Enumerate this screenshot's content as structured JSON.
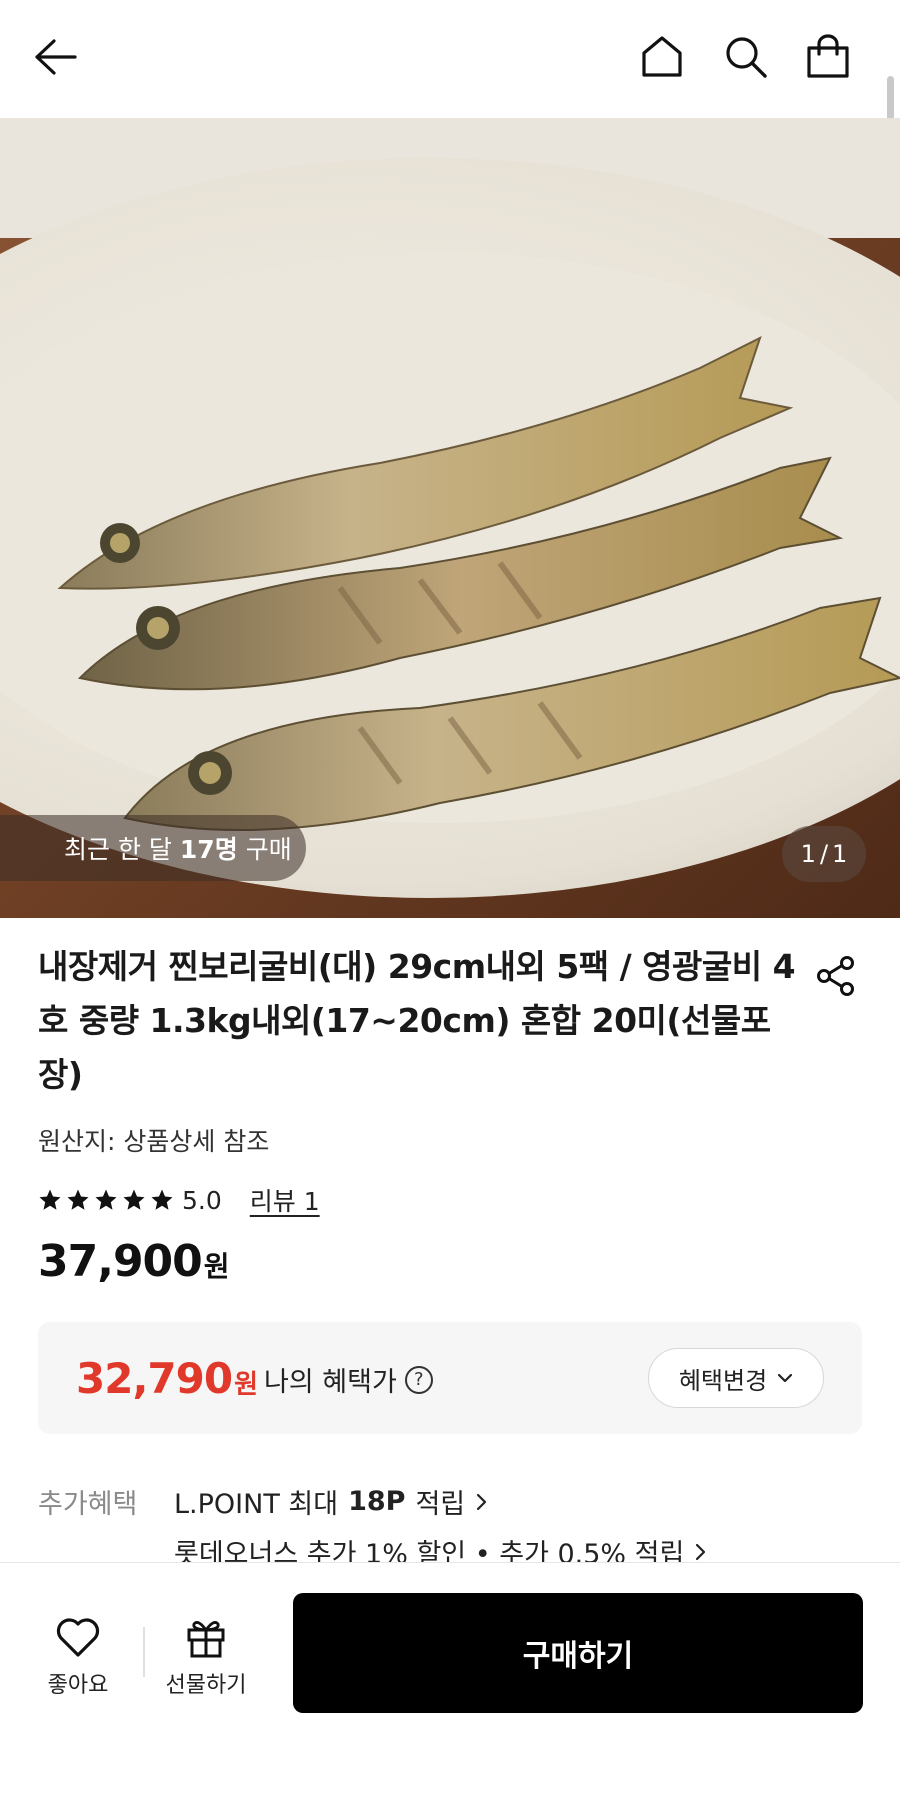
{
  "header": {
    "back_icon": "arrow-left-icon",
    "home_icon": "home-icon",
    "search_icon": "search-icon",
    "bag_icon": "shopping-bag-icon"
  },
  "hero": {
    "image_desc_icon": "product-photo",
    "recent_prefix": "최근 한 달",
    "recent_count": "17명",
    "recent_suffix": "구매",
    "page_current": "1",
    "page_sep": "/",
    "page_total": "1"
  },
  "product": {
    "title": "내장제거 찐보리굴비(대) 29cm내외 5팩 / 영광굴비 4호 중량 1.3kg내외(17~20cm) 혼합 20미(선물포장)",
    "share_icon": "share-icon",
    "origin": "원산지: 상품상세 참조",
    "rating": "5.0",
    "rating_stars": 5,
    "review_link": "리뷰 1",
    "price": "37,900",
    "price_unit": "원"
  },
  "benefit": {
    "price": "32,790",
    "price_unit": "원",
    "label": "나의 혜택가",
    "help_icon": "question-circle-icon",
    "change_button": "혜택변경",
    "accent_color": "#e0392b"
  },
  "extra": {
    "label": "추가혜택",
    "row1_prefix": "L.POINT 최대",
    "row1_bold": "18P",
    "row1_suffix": "적립",
    "row2": "롯데오너스 추가 1% 할인 • 추가 0.5% 적립"
  },
  "bottom_bar": {
    "like_label": "좋아요",
    "gift_label": "선물하기",
    "buy_label": "구매하기"
  }
}
